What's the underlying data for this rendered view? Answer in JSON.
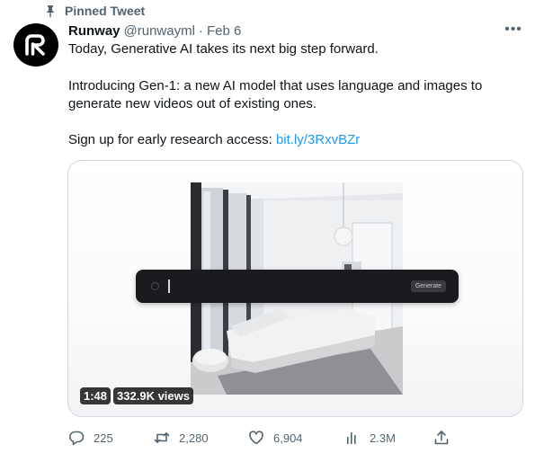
{
  "pinned": {
    "label": "Pinned Tweet",
    "icon": "pin-icon"
  },
  "author": {
    "name": "Runway",
    "handle": "@runwayml",
    "separator": "·",
    "date": "Feb 6",
    "avatar_icon": "runway-logo-icon"
  },
  "tweet": {
    "line1": "Today, Generative AI takes its next big step forward.",
    "paragraph2": "Introducing Gen-1: a new AI model that uses language and images to generate new videos out of existing ones.",
    "signup_text": "Sign up for early research access: ",
    "signup_link": "bit.ly/3RxvBZr"
  },
  "media": {
    "duration": "1:48",
    "views": "332.9K views",
    "prompt_button": "Generate"
  },
  "actions": {
    "replies": "225",
    "retweets": "2,280",
    "likes": "6,904",
    "views": "2.3M"
  },
  "colors": {
    "link": "#1d9bf0",
    "muted": "#536471",
    "text": "#0f1419"
  }
}
